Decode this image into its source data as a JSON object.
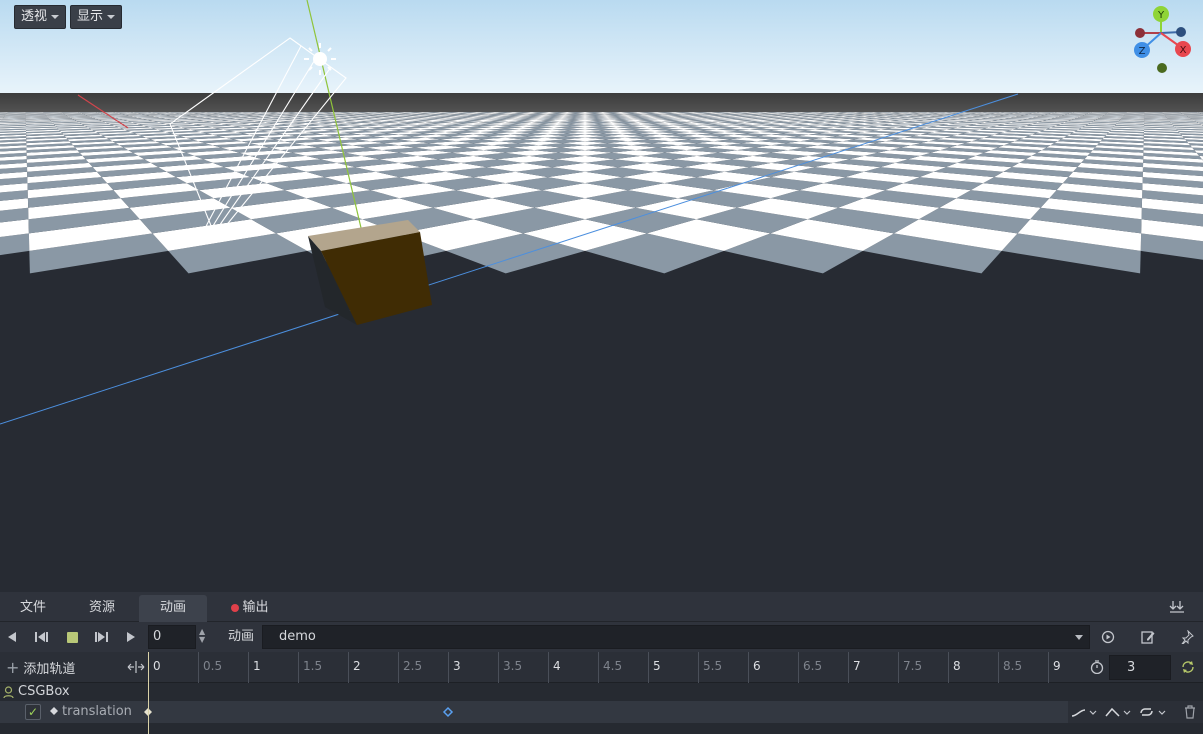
{
  "viewport": {
    "perspective_menu": "透视",
    "display_menu": "显示",
    "gizmo": {
      "y_label": "Y",
      "z_label": "Z",
      "x_label": "X"
    }
  },
  "bottom_tabs": [
    {
      "label": "文件"
    },
    {
      "label": "资源"
    },
    {
      "label": "动画",
      "active": true
    },
    {
      "label": "输出",
      "has_error": true
    }
  ],
  "animation_bar": {
    "current_frame": "0",
    "animation_label": "动画",
    "selected_animation": "demo"
  },
  "timeline": {
    "add_track_label": "添加轨道",
    "ticks": [
      "0",
      "0.5",
      "1",
      "1.5",
      "2",
      "2.5",
      "3",
      "3.5",
      "4",
      "4.5",
      "5",
      "5.5",
      "6",
      "6.5",
      "7",
      "7.5",
      "8",
      "8.5",
      "9"
    ],
    "length": "3",
    "playhead_time": 0
  },
  "tracks": {
    "node_name": "CSGBox",
    "property_name": "translation",
    "keyframes": [
      0,
      3
    ]
  },
  "colors": {
    "sky_top": "#b8d8ee",
    "sky_bottom": "#e8f4fb",
    "horizon": "#4a4a4a",
    "tile_dark": "#8a98a5",
    "tile_light": "#ffffff",
    "cube": "#3f2d08",
    "axis_x": "#e8474f",
    "axis_y": "#8fd436",
    "axis_z": "#3f8fe6",
    "error_dot": "#e0404a"
  }
}
